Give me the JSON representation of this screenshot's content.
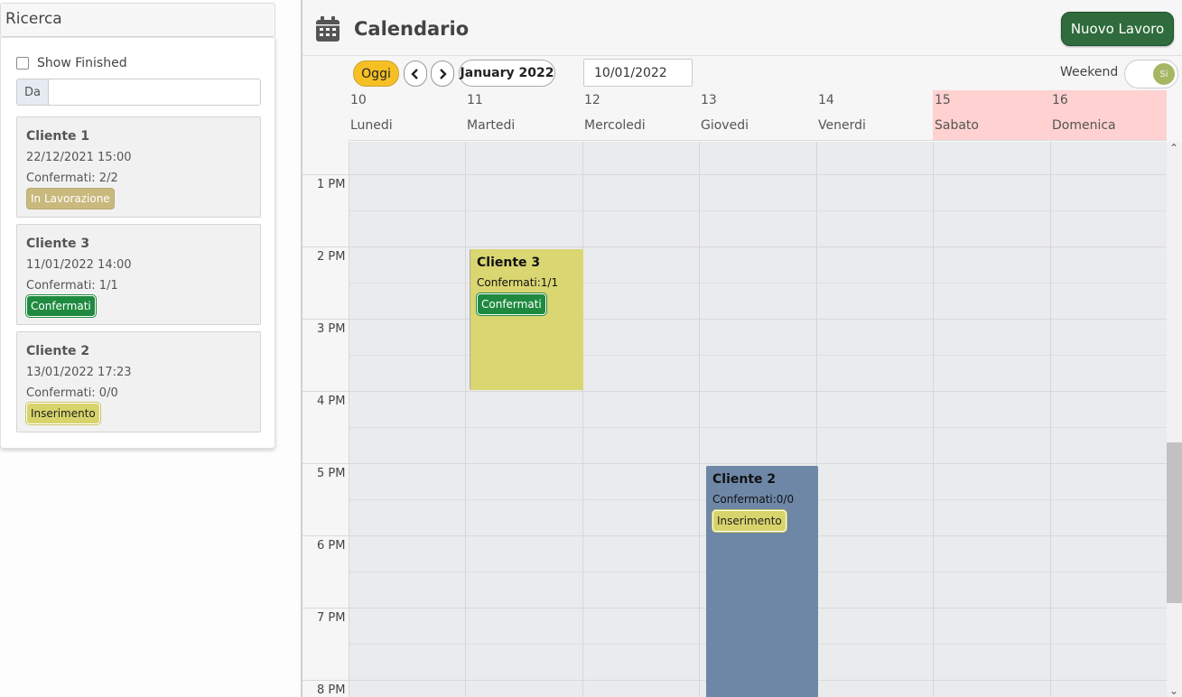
{
  "sidebar": {
    "title": "Ricerca",
    "show_finished_label": "Show Finished",
    "da_label": "Da",
    "da_value": "",
    "jobs": [
      {
        "name": "Cliente 1",
        "date": "22/12/2021 15:00",
        "confirmed": "Confermati: 2/2",
        "status": "In Lavorazione"
      },
      {
        "name": "Cliente 3",
        "date": "11/01/2022 14:00",
        "confirmed": "Confermati: 1/1",
        "status": "Confermati"
      },
      {
        "name": "Cliente 2",
        "date": "13/01/2022 17:23",
        "confirmed": "Confermati: 0/0",
        "status": "Inserimento"
      }
    ]
  },
  "header": {
    "icon": "calendar-icon",
    "title": "Calendario",
    "new_job_label": "Nuovo Lavoro"
  },
  "toolbar": {
    "today_label": "Oggi",
    "prev_icon": "chevron-left-icon",
    "next_icon": "chevron-right-icon",
    "month_label": "January 2022",
    "date_value": "10/01/2022",
    "weekend_label": "Weekend",
    "weekend_toggle": "Si"
  },
  "days": [
    {
      "num": "10",
      "name": "Lunedi",
      "weekend": false
    },
    {
      "num": "11",
      "name": "Martedi",
      "weekend": false
    },
    {
      "num": "12",
      "name": "Mercoledi",
      "weekend": false
    },
    {
      "num": "13",
      "name": "Giovedi",
      "weekend": false
    },
    {
      "num": "14",
      "name": "Venerdi",
      "weekend": false
    },
    {
      "num": "15",
      "name": "Sabato",
      "weekend": true
    },
    {
      "num": "16",
      "name": "Domenica",
      "weekend": true
    }
  ],
  "times": [
    "1 PM",
    "2 PM",
    "3 PM",
    "4 PM",
    "5 PM",
    "6 PM",
    "7 PM",
    "8 PM"
  ],
  "events": [
    {
      "name": "Cliente 3",
      "confirmed": "Confermati:1/1",
      "status": "Confermati",
      "day": "11",
      "start": "14:00",
      "end": "16:00",
      "color": "#dad672"
    },
    {
      "name": "Cliente 2",
      "confirmed": "Confermati:0/0",
      "status": "Inserimento",
      "day": "13",
      "start": "17:00",
      "end": "20:00+",
      "color": "#6e87a7"
    }
  ],
  "colors": {
    "today_button": "#f6c025",
    "new_job_button": "#2f6b3c",
    "weekend_header": "#ffd1d1",
    "status_confermati": "#1f8a3f",
    "status_inserimento": "#d8d46c",
    "status_in_lavorazione": "#c9b97d"
  }
}
